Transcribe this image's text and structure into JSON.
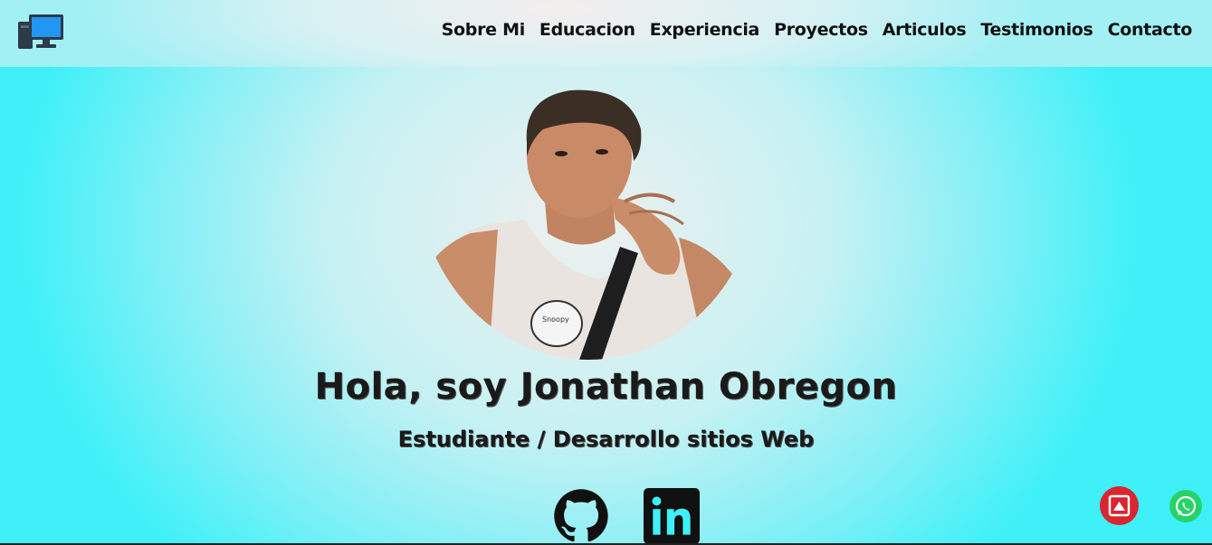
{
  "header": {
    "logo_icon": "desktop-computer-icon",
    "nav": [
      {
        "label": "Sobre Mi"
      },
      {
        "label": "Educacion"
      },
      {
        "label": "Experiencia"
      },
      {
        "label": "Proyectos"
      },
      {
        "label": "Articulos"
      },
      {
        "label": "Testimonios"
      },
      {
        "label": "Contacto"
      }
    ]
  },
  "hero": {
    "title": "Hola, soy Jonathan Obregon",
    "subtitle": "Estudiante / Desarrollo sitios Web",
    "social": [
      {
        "icon": "github-icon"
      },
      {
        "icon": "linkedin-icon"
      }
    ]
  },
  "floating": {
    "scroll_top_icon": "image-up-icon",
    "whatsapp_icon": "whatsapp-icon"
  },
  "colors": {
    "background": "#3ff0f8",
    "scroll_top_button": "#d9252f",
    "whatsapp": "#25d366",
    "text": "#111111"
  }
}
